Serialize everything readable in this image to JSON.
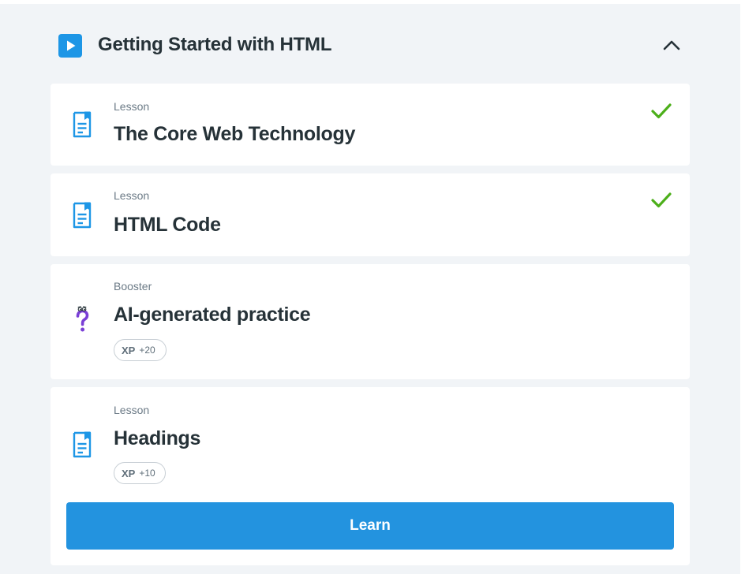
{
  "section": {
    "title": "Getting Started with HTML",
    "icon": "play-icon",
    "toggle_icon": "chevron-up-icon",
    "accent_color": "#1d96e6"
  },
  "items": [
    {
      "type": "Lesson",
      "title": "The Core Web Technology",
      "icon": "lesson-document-icon",
      "status": "completed",
      "status_icon": "checkmark-icon"
    },
    {
      "type": "Lesson",
      "title": "HTML Code",
      "icon": "lesson-document-icon",
      "status": "completed",
      "status_icon": "checkmark-icon"
    },
    {
      "type": "Booster",
      "title": "AI-generated practice",
      "icon": "question-mark-character-icon",
      "xp_label": "XP",
      "xp_value": "+20"
    },
    {
      "type": "Lesson",
      "title": "Headings",
      "icon": "lesson-document-icon",
      "xp_label": "XP",
      "xp_value": "+10",
      "action_label": "Learn"
    }
  ],
  "colors": {
    "completed_check": "#4caf1a",
    "primary_button": "#2393df",
    "lesson_icon": "#1d96e6",
    "booster_icon": "#7a3fd6"
  }
}
